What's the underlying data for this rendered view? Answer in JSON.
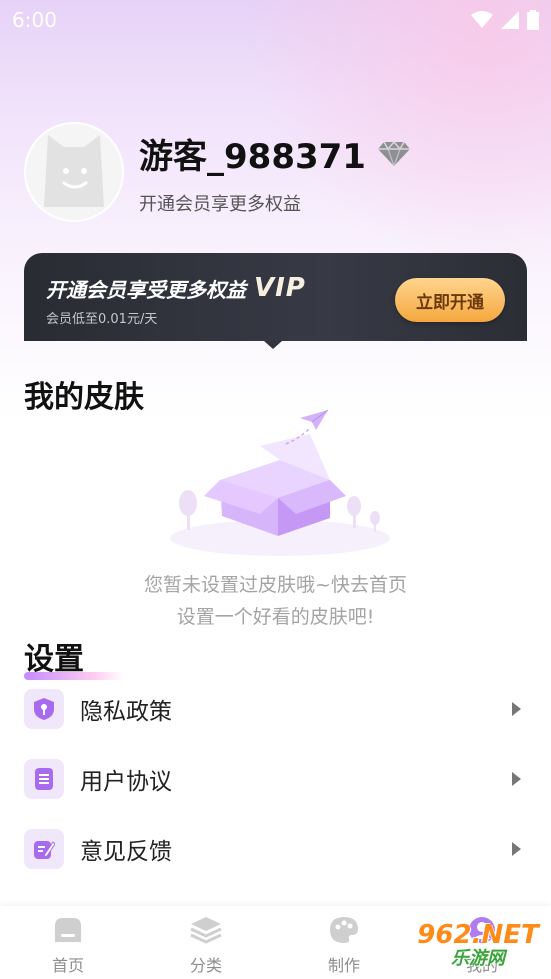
{
  "status_bar": {
    "time": "6:00"
  },
  "profile": {
    "username": "游客_988371",
    "subtitle": "开通会员享更多权益"
  },
  "vip_card": {
    "title": "开通会员享受更多权益",
    "badge": "VIP",
    "subtitle": "会员低至0.01元/天",
    "button_label": "立即开通"
  },
  "skins": {
    "title": "我的皮肤",
    "empty_line1": "您暂未设置过皮肤哦~快去首页",
    "empty_line2": "设置一个好看的皮肤吧!"
  },
  "settings": {
    "title": "设置",
    "items": [
      {
        "label": "隐私政策",
        "icon": "shield-key-icon"
      },
      {
        "label": "用户协议",
        "icon": "document-icon"
      },
      {
        "label": "意见反馈",
        "icon": "edit-icon"
      }
    ]
  },
  "tab_bar": {
    "tabs": [
      {
        "label": "首页",
        "icon": "home-icon"
      },
      {
        "label": "分类",
        "icon": "layers-icon"
      },
      {
        "label": "制作",
        "icon": "palette-icon"
      },
      {
        "label": "我的",
        "icon": "profile-icon"
      }
    ]
  },
  "watermark": {
    "top": "962.NET",
    "bottom": "乐游网"
  },
  "colors": {
    "accent_purple": "#b07cf0",
    "vip_gold": "#f5a73e",
    "vip_dark": "#2a2c34"
  }
}
